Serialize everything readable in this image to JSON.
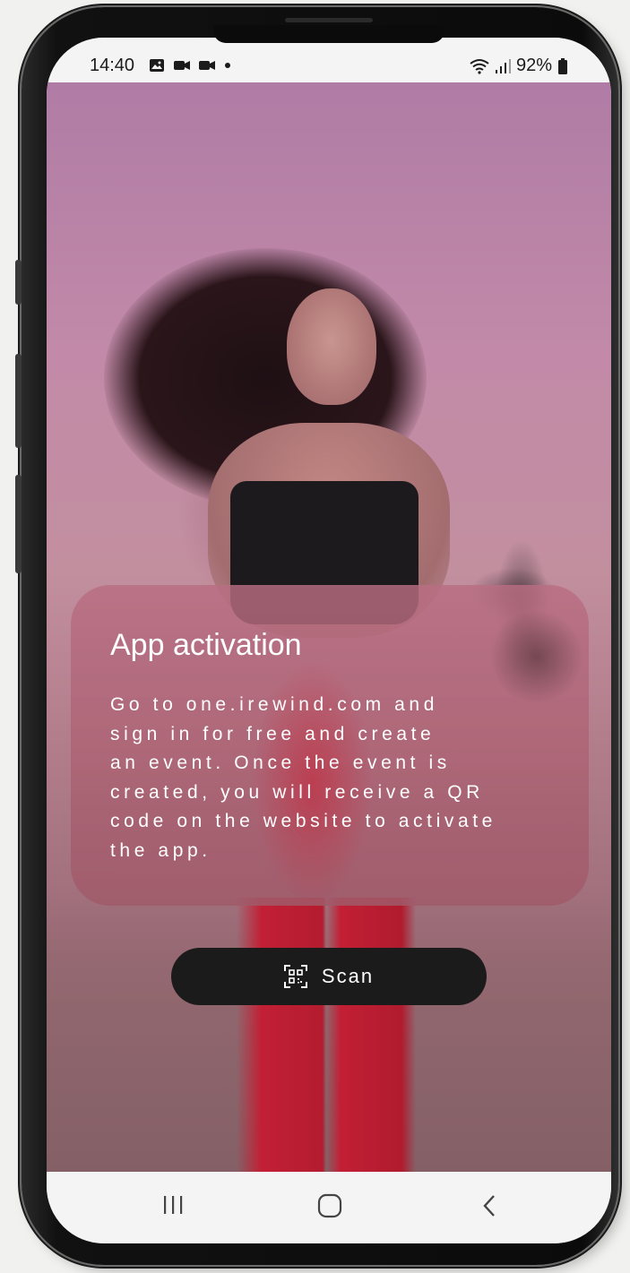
{
  "status_bar": {
    "time": "14:40",
    "left_icons": [
      "gallery-icon",
      "video-camera-icon",
      "video-camera-icon",
      "dot-icon"
    ],
    "right_icons": [
      "wifi-icon",
      "signal-icon",
      "battery-icon"
    ],
    "battery": "92%"
  },
  "activation_card": {
    "title": "App activation",
    "body": "Go to one.irewind.com and\nsign in for free and create\nan event. Once the event is\ncreated, you will receive a QR\ncode on the website to activate\nthe app."
  },
  "scan_button": {
    "label": "Scan",
    "icon": "qr-scan-icon"
  },
  "nav_bar": {
    "items": [
      "recent-apps-icon",
      "home-icon",
      "back-icon"
    ]
  }
}
